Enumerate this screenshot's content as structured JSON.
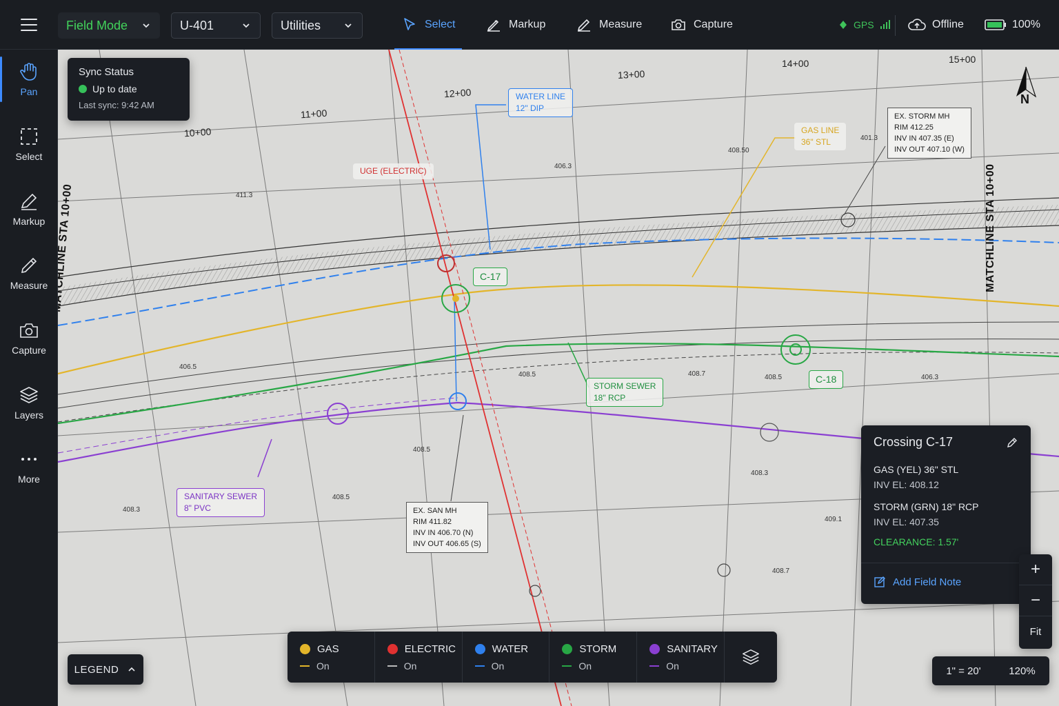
{
  "topbar": {
    "mode": "Field Mode",
    "sheet": "U-401",
    "layer_filter": "Utilities",
    "tools": [
      {
        "label": "Select",
        "icon": "cursor-icon",
        "active": true
      },
      {
        "label": "Markup",
        "icon": "pen-icon"
      },
      {
        "label": "Measure",
        "icon": "pencil-icon"
      },
      {
        "label": "Capture",
        "icon": "camera-icon"
      }
    ],
    "gps_label": "GPS",
    "offline_label": "Offline",
    "battery": "100%"
  },
  "rail": [
    {
      "label": "Pan",
      "icon": "hand-icon",
      "active": true
    },
    {
      "label": "Select",
      "icon": "marquee-icon"
    },
    {
      "label": "Markup",
      "icon": "pen-icon"
    },
    {
      "label": "Measure",
      "icon": "pencil-icon"
    },
    {
      "label": "Capture",
      "icon": "camera-icon"
    },
    {
      "label": "Layers",
      "icon": "layers-icon"
    },
    {
      "label": "More",
      "icon": "more-icon"
    }
  ],
  "sync": {
    "title": "Sync Status",
    "state": "Up to date",
    "last": "Last sync: 9:42 AM"
  },
  "map": {
    "stations": [
      "10+00",
      "11+00",
      "12+00",
      "13+00",
      "14+00",
      "15+00"
    ],
    "matchline_left": "MATCHLINE STA 10+00",
    "matchline_right": "MATCHLINE STA 10+00",
    "north": "N",
    "callouts": {
      "water": [
        "WATER LINE",
        "12\" DIP"
      ],
      "electric": "UGE (ELECTRIC)",
      "gas": [
        "GAS LINE",
        "36\" STL"
      ],
      "storm": [
        "STORM SEWER",
        "18\" RCP"
      ],
      "sanitary": [
        "SANITARY SEWER",
        "8\" PVC"
      ],
      "c17": "C-17",
      "c18": "C-18"
    },
    "storm_mh": [
      "EX. STORM MH",
      "RIM 412.25",
      "INV IN 407.35 (E)",
      "INV OUT 407.10 (W)"
    ],
    "san_mh": [
      "EX. SAN MH",
      "RIM 411.82",
      "INV IN 406.70 (N)",
      "INV OUT 406.65 (S)"
    ],
    "spot_elevations": [
      "411.3",
      "406.3",
      "408.50",
      "401.3",
      "406.5",
      "408.5",
      "408.7",
      "408.5",
      "406.3",
      "408.3",
      "408.5",
      "408.5",
      "408.3",
      "409.1",
      "408.7"
    ]
  },
  "crossing": {
    "title": "Crossing C-17",
    "gas": "GAS (YEL) 36\" STL",
    "gas_inv": "INV EL: 408.12",
    "storm": "STORM (GRN) 18\" RCP",
    "storm_inv": "INV EL: 407.35",
    "clearance": "CLEARANCE: 1.57'",
    "add_note": "Add Field Note"
  },
  "zoom": {
    "plus": "+",
    "minus": "−",
    "fit": "Fit"
  },
  "scale": {
    "ratio": "1\" = 20'",
    "zoom": "120%"
  },
  "legend_label": "LEGEND",
  "utilities": [
    {
      "name": "GAS",
      "state": "On",
      "color": "#e3b52a"
    },
    {
      "name": "ELECTRIC",
      "state": "On",
      "color": "#e03131"
    },
    {
      "name": "WATER",
      "state": "On",
      "color": "#2f80ed"
    },
    {
      "name": "STORM",
      "state": "On",
      "color": "#28a745"
    },
    {
      "name": "SANITARY",
      "state": "On",
      "color": "#8a3fd1"
    }
  ],
  "colors": {
    "accent": "#3d8bff",
    "mode_green": "#42d35b",
    "gas": "#e3b52a",
    "electric": "#e03131",
    "water": "#2f80ed",
    "storm": "#28a745",
    "sanitary": "#8a3fd1"
  }
}
